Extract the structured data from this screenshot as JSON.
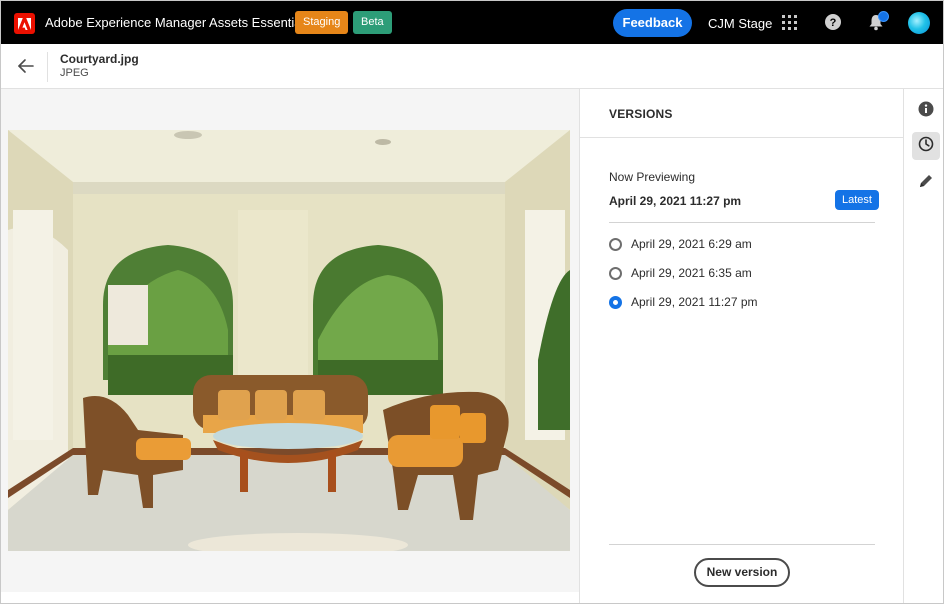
{
  "topbar": {
    "app_title": "Adobe Experience Manager Assets Essentials",
    "badge_staging": "Staging",
    "badge_beta": "Beta",
    "feedback_label": "Feedback",
    "org_name": "CJM Stage",
    "icons": [
      "adobe-logo",
      "apps-icon",
      "help-icon",
      "bell-icon",
      "avatar"
    ]
  },
  "asset": {
    "name": "Courtyard.jpg",
    "type": "JPEG"
  },
  "versions_panel": {
    "title": "VERSIONS",
    "now_previewing_label": "Now Previewing",
    "now_previewing_date": "April 29, 2021 11:27 pm",
    "latest_badge": "Latest",
    "items": [
      {
        "label": "April 29, 2021 6:29 am",
        "selected": false
      },
      {
        "label": "April 29, 2021 6:35 am",
        "selected": false
      },
      {
        "label": "April 29, 2021 11:27 pm",
        "selected": true
      }
    ],
    "new_version_label": "New version"
  },
  "rail": {
    "icons": [
      "info-icon",
      "history-icon",
      "edit-icon"
    ],
    "active": "history-icon"
  },
  "colors": {
    "accent": "#1473e6",
    "staging": "#e68619",
    "beta": "#2d9d78",
    "adobe_red": "#eb1000"
  }
}
